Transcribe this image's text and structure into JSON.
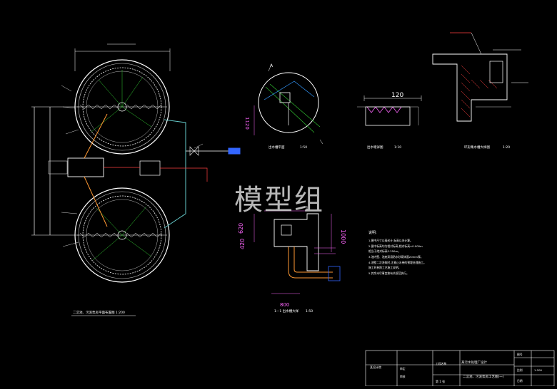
{
  "watermark": "模型组",
  "labels": {
    "dim_top": "",
    "dim_120": "120",
    "dim_1120": "1120",
    "dim_620": "620",
    "dim_420": "420",
    "dim_1000": "1000",
    "dim_800": "800",
    "section_a": "A",
    "sec_1": "1",
    "plan_caption": "二沉池、污泥泵房平面布置图 1:200",
    "detail1_caption": "出水槽平面",
    "detail1_scale": "1:50",
    "detail2_caption": "出水堰详图",
    "detail2_scale": "1:10",
    "detail3_caption": "环形集水槽大样图",
    "detail3_scale": "1:20",
    "section_caption": "1—1 出水槽大样",
    "section_scale": "1:50",
    "notes_title": "说明:",
    "notes": [
      "1.图中尺寸以毫米计,标高以米计算。",
      "2.图中标高均为相对标高,相对标高±0.000m",
      "  相当于绝对标高2.250m。",
      "3.池内壁、池底采用防水砂浆抹面20mm厚。",
      "4.池壁二次浇筑时,注意止水带的预埋处理施工。",
      "  施工时参照工艺施工说明。",
      "5.其余未尽事宜按有关规范执行。"
    ]
  },
  "title_block": {
    "unit": "某设计院",
    "project": "某污水处理厂设计",
    "drawing": "二沉池、污泥泵房工艺图(一)",
    "row_labels": [
      "审定",
      "审核",
      "校对",
      "设计",
      "制图"
    ],
    "cells": [
      "工程名称",
      "图名",
      "图号",
      "比例",
      "日期"
    ],
    "sheet": "第 1 张",
    "scale": "1:200"
  }
}
